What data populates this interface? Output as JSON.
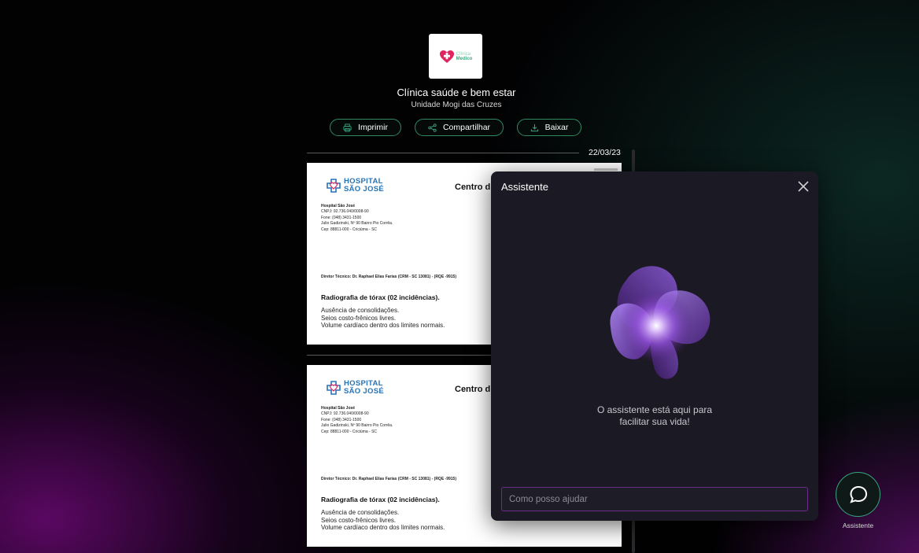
{
  "clinic": {
    "logo_text": [
      "Clínica",
      "Medico"
    ],
    "name": "Clínica saúde e bem estar",
    "unit": "Unidade Mogi das Cruzes"
  },
  "actions": {
    "print": "Imprimir",
    "share": "Compartilhar",
    "download": "Baixar"
  },
  "date": "22/03/23",
  "documents": [
    {
      "hospital_name_line1": "HOSPITAL",
      "hospital_name_line2": "SÃO JOSÉ",
      "header_title": "Centro di",
      "info_name": "Hospital São José",
      "info_cnpj": "CNPJ: 92.736.040/0008-90",
      "info_phone": "Fone: (048) 3431-1500",
      "info_address": "Julio Gadizinski, Nº 90 Bairro Pio Corrêa.",
      "info_cep": "Cep: 88811-000 - Criciúma - SC",
      "director": "Diretor Técnico: Dr. Raphael Elias Farias (CRM - SC 13081) - (RQE -9915)",
      "exam": "Radiografia de tórax (02 incidências).",
      "findings": [
        "Ausência de consolidações.",
        "Seios costo-frênicos livres.",
        "Volume cardíaco dentro dos limites normais."
      ]
    },
    {
      "hospital_name_line1": "HOSPITAL",
      "hospital_name_line2": "SÃO JOSÉ",
      "header_title": "Centro di",
      "info_name": "Hospital São José",
      "info_cnpj": "CNPJ: 92.736.040/0008-90",
      "info_phone": "Fone: (048) 3431-1500",
      "info_address": "Julio Gadizinski, Nº 90 Bairro Pio Corrêa.",
      "info_cep": "Cep: 88811-000 - Criciúma - SC",
      "director": "Diretor Técnico: Dr. Raphael Elias Farias (CRM - SC 13081) - (RQE -9915)",
      "exam": "Radiografia de tórax (02 incidências).",
      "findings": [
        "Ausência de consolidações.",
        "Seios costo-frênicos livres.",
        "Volume cardíaco dentro dos limites normais."
      ]
    }
  ],
  "assistant": {
    "title": "Assistente",
    "message_line1": "O assistente está aqui para",
    "message_line2": "facilitar sua vida!",
    "input_placeholder": "Como posso ajudar"
  },
  "fab": {
    "label": "Assistente"
  },
  "colors": {
    "accent_green": "#2f8a62",
    "accent_purple": "#6b2b8a",
    "hospital_blue": "#2773b5",
    "brand_pink": "#e0245e"
  }
}
